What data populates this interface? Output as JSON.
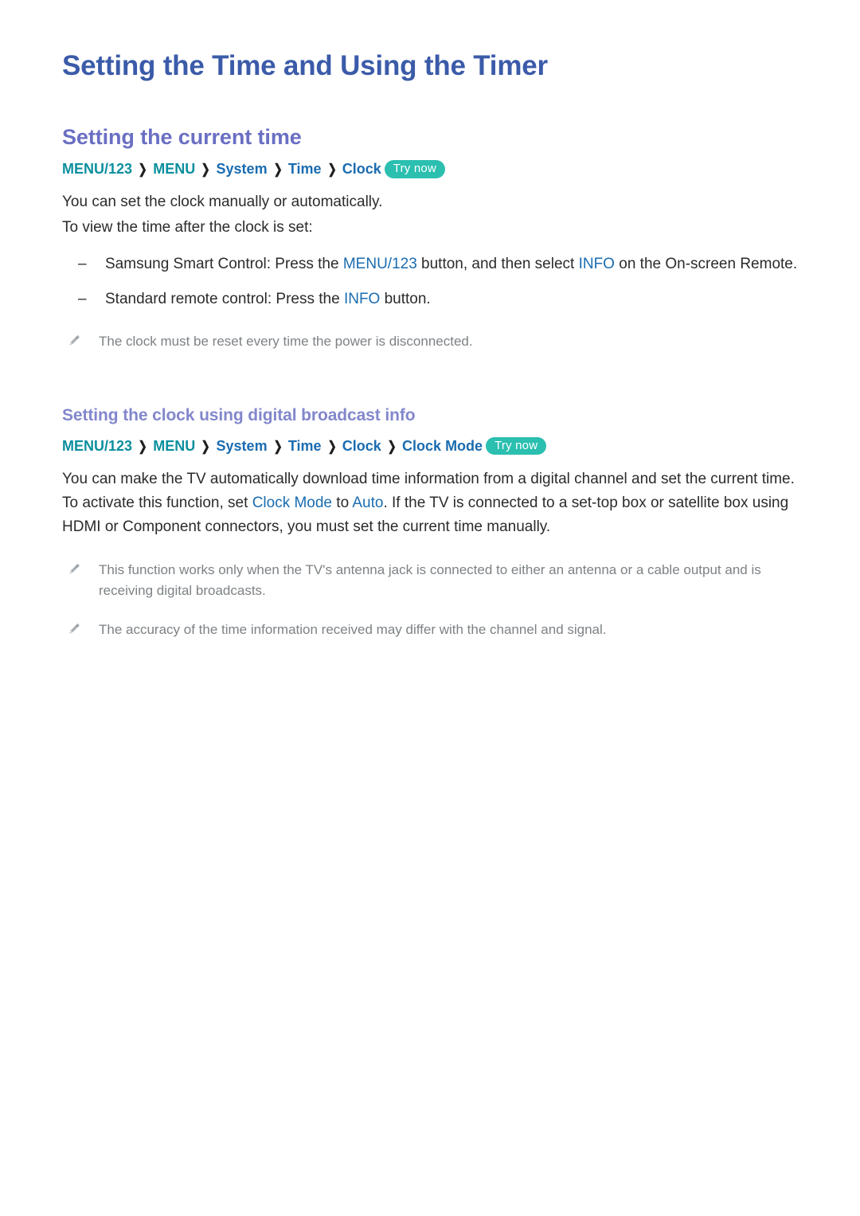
{
  "document": {
    "title": "Setting the Time and Using the Timer"
  },
  "sections": [
    {
      "heading": "Setting the current time",
      "breadcrumb": {
        "items": [
          {
            "label": "MENU/123",
            "style": "teal"
          },
          {
            "label": "MENU",
            "style": "teal"
          },
          {
            "label": "System",
            "style": "blue"
          },
          {
            "label": "Time",
            "style": "blue"
          },
          {
            "label": "Clock",
            "style": "blue"
          }
        ],
        "separator": "❯",
        "badge": "Try now"
      },
      "paragraphs": [
        "You can set the clock manually or automatically.",
        "To view the time after the clock is set:"
      ],
      "list": [
        {
          "marker": "–",
          "parts": [
            {
              "text": "Samsung Smart Control: Press the ",
              "style": "plain"
            },
            {
              "text": "MENU/123",
              "style": "keyword"
            },
            {
              "text": " button, and then select ",
              "style": "plain"
            },
            {
              "text": "INFO",
              "style": "keyword"
            },
            {
              "text": " on the On-screen Remote.",
              "style": "plain"
            }
          ]
        },
        {
          "marker": "–",
          "parts": [
            {
              "text": "Standard remote control: Press the ",
              "style": "plain"
            },
            {
              "text": "INFO",
              "style": "keyword"
            },
            {
              "text": " button.",
              "style": "plain"
            }
          ]
        }
      ],
      "notes": [
        {
          "icon": "pencil-icon",
          "text": "The clock must be reset every time the power is disconnected."
        }
      ]
    },
    {
      "heading": "Setting the clock using digital broadcast info",
      "heading_level": "h3",
      "breadcrumb": {
        "items": [
          {
            "label": "MENU/123",
            "style": "teal"
          },
          {
            "label": "MENU",
            "style": "teal"
          },
          {
            "label": "System",
            "style": "blue"
          },
          {
            "label": "Time",
            "style": "blue"
          },
          {
            "label": "Clock",
            "style": "blue"
          },
          {
            "label": "Clock Mode",
            "style": "blue"
          }
        ],
        "separator": "❯",
        "badge": "Try now"
      },
      "body_parts": [
        {
          "text": "You can make the TV automatically download time information from a digital channel and set the current time. To activate this function, set ",
          "style": "plain"
        },
        {
          "text": "Clock Mode",
          "style": "keyword"
        },
        {
          "text": " to ",
          "style": "plain"
        },
        {
          "text": "Auto",
          "style": "keyword"
        },
        {
          "text": ". If the TV is connected to a set-top box or satellite box using HDMI or Component connectors, you must set the current time manually.",
          "style": "plain"
        }
      ],
      "notes": [
        {
          "icon": "pencil-icon",
          "text": "This function works only when the TV's antenna jack is connected to either an antenna or a cable output and is receiving digital broadcasts."
        },
        {
          "icon": "pencil-icon",
          "text": "The accuracy of the time information received may differ with the channel and signal."
        }
      ]
    }
  ],
  "colors": {
    "title": "#3b5ba9",
    "heading2": "#6a6fc3",
    "heading3": "#8287cc",
    "breadcrumb_teal": "#0c8f9e",
    "breadcrumb_blue": "#1a6cb0",
    "badge_bg": "#2bbfb0",
    "body": "#2b2b2b",
    "note": "#7d8285"
  }
}
